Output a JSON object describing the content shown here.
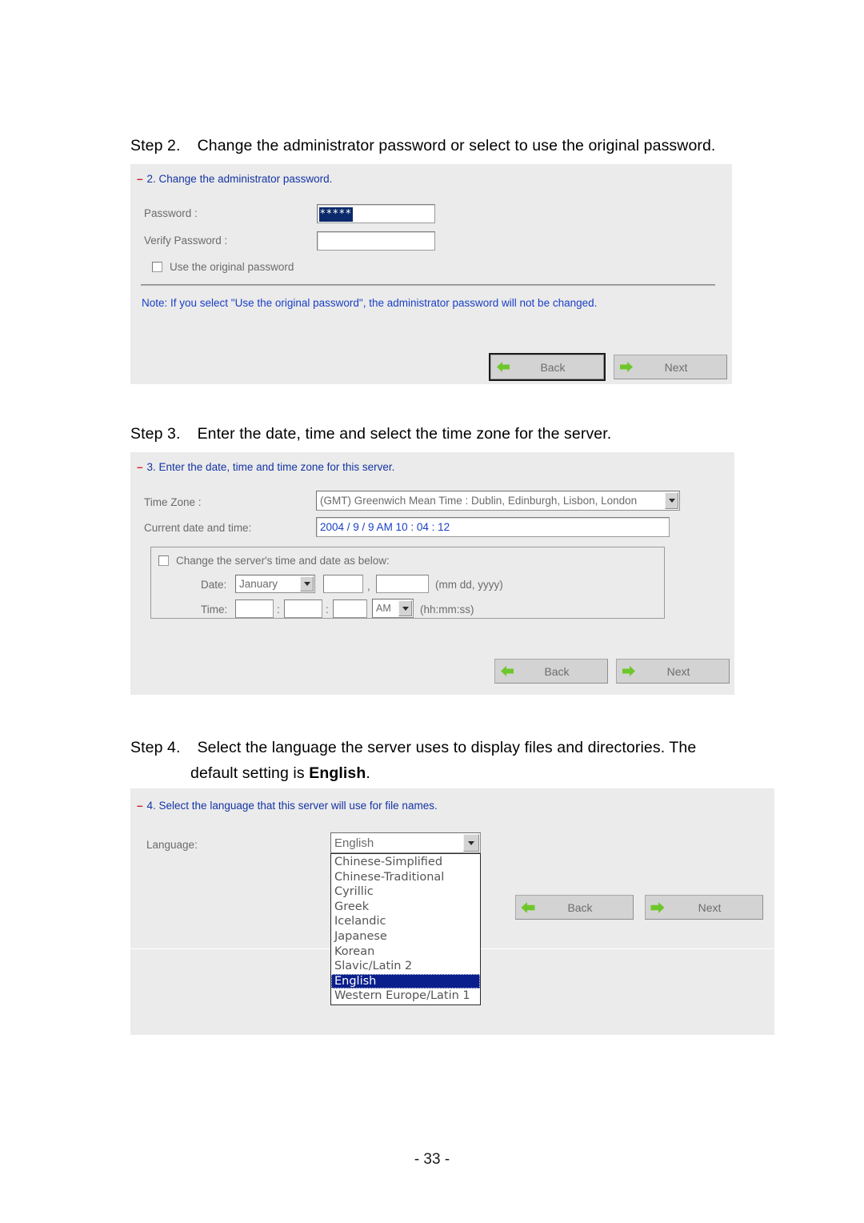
{
  "document": {
    "page_number": "- 33 -",
    "steps": [
      {
        "id": "step2",
        "heading_prefix": "Step 2.",
        "heading_text": "Change the administrator password or select to use the original password."
      },
      {
        "id": "step3",
        "heading_prefix": "Step 3.",
        "heading_text": "Enter the date, time and select the time zone for the server."
      },
      {
        "id": "step4",
        "heading_prefix": "Step 4.",
        "heading_line1": "Select the language the server uses to display files and directories.  The",
        "heading_line2_pre": "default setting is ",
        "heading_line2_bold": "English",
        "heading_line2_post": "."
      }
    ]
  },
  "panel2": {
    "marker": "–",
    "title": "2. Change the administrator password.",
    "password_label": "Password :",
    "password_value": "*****",
    "verify_label": "Verify Password :",
    "verify_value": "",
    "checkbox_label": "Use the original password",
    "checkbox_checked": false,
    "note": "Note: If you select \"Use the original password\", the administrator password will not be changed.",
    "back_label": "Back",
    "next_label": "Next"
  },
  "panel3": {
    "marker": "–",
    "title": "3. Enter the date, time and time zone for this server.",
    "timezone_label": "Time Zone :",
    "timezone_value": "(GMT) Greenwich Mean Time : Dublin, Edinburgh, Lisbon, London",
    "current_label": "Current date and time:",
    "current_value": "2004 / 9 / 9 AM 10 : 04 : 12",
    "change_checkbox_label": "Change the server's time and date as below:",
    "change_checkbox_checked": false,
    "date_label": "Date:",
    "month_value": "January",
    "day_value": "",
    "year_value": "",
    "date_format_hint": "(mm dd, yyyy)",
    "date_comma": ",",
    "time_label": "Time:",
    "hour_value": "",
    "minute_value": "",
    "second_value": "",
    "time_colon": ":",
    "meridiem_value": "AM",
    "time_format_hint": "(hh:mm:ss)",
    "back_label": "Back",
    "next_label": "Next"
  },
  "panel4": {
    "marker": "–",
    "title": "4. Select the language that this server will use for file names.",
    "language_label": "Language:",
    "language_value": "English",
    "options": [
      "Chinese-Simplified",
      "Chinese-Traditional",
      "Cyrillic",
      "Greek",
      "Icelandic",
      "Japanese",
      "Korean",
      "Slavic/Latin 2",
      "English",
      "Western Europe/Latin 1"
    ],
    "selected_option": "English",
    "back_label": "Back",
    "next_label": "Next"
  },
  "colors": {
    "panel_bg": "#ebebeb",
    "title_blue": "#1434a4",
    "marker_red": "#d32222",
    "label_gray": "#6b6b6b",
    "selection_blue": "#0b1f8c",
    "arrow_green": "#6ec72a"
  }
}
